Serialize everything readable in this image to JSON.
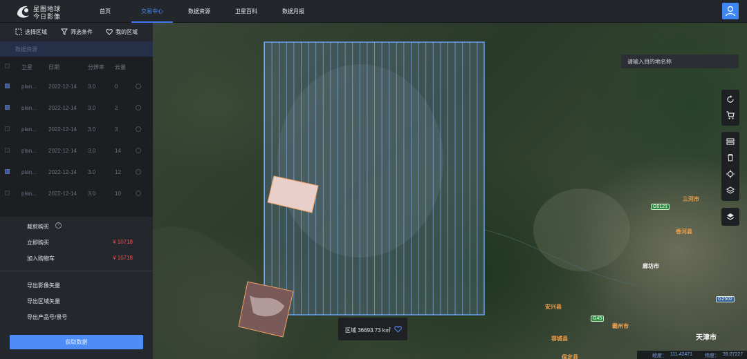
{
  "brand": {
    "line1": "星图地球",
    "line2": "今日影像"
  },
  "nav": [
    {
      "label": "首页",
      "active": false
    },
    {
      "label": "交易中心",
      "active": true
    },
    {
      "label": "数据资源",
      "active": false
    },
    {
      "label": "卫星百科",
      "active": false
    },
    {
      "label": "数据月报",
      "active": false
    }
  ],
  "panel": {
    "tabs": [
      {
        "label": "选择区域",
        "icon": "select-area-icon"
      },
      {
        "label": "筛选条件",
        "icon": "filter-icon"
      },
      {
        "label": "我的区域",
        "icon": "heart-icon"
      }
    ],
    "section_title": "数据资源",
    "table": {
      "headers": [
        "卫星",
        "日期",
        "分辨率",
        "云量"
      ],
      "rows": [
        {
          "checked": true,
          "satellite": "plan...",
          "date": "2022-12-14",
          "resolution": "3.0",
          "cloud": "0"
        },
        {
          "checked": true,
          "satellite": "plan...",
          "date": "2022-12-14",
          "resolution": "3.0",
          "cloud": "2"
        },
        {
          "checked": false,
          "satellite": "plan...",
          "date": "2022-12-14",
          "resolution": "3.0",
          "cloud": "3"
        },
        {
          "checked": false,
          "satellite": "plan...",
          "date": "2022-12-14",
          "resolution": "3.0",
          "cloud": "14"
        },
        {
          "checked": true,
          "satellite": "plan...",
          "date": "2022-12-14",
          "resolution": "3.0",
          "cloud": "12"
        },
        {
          "checked": false,
          "satellite": "plan...",
          "date": "2022-12-14",
          "resolution": "3.0",
          "cloud": "10"
        }
      ]
    },
    "buy": {
      "crop_label": "裁剪购买",
      "buy_now_label": "立即购买",
      "buy_now_price": "¥ 10718",
      "cart_label": "加入购物车",
      "cart_price": "¥ 10718"
    },
    "exports": [
      "导出影像矢量",
      "导出区域矢量",
      "导出产品号/景号"
    ],
    "primary_button": "获取数据"
  },
  "map": {
    "search_placeholder": "请输入目的地名称",
    "area_label": "区域 36693.73 k㎡",
    "coords": {
      "lon_label": "经度：",
      "lon": "111.42471",
      "lat_label": "纬度：",
      "lat": "39.07227"
    },
    "cities": [
      {
        "name": "天津市",
        "style": "white"
      },
      {
        "name": "三河市",
        "style": "orange"
      },
      {
        "name": "香河县",
        "style": "orange"
      },
      {
        "name": "廊坊市",
        "style": "white"
      },
      {
        "name": "安兴县",
        "style": "orange"
      },
      {
        "name": "霸州市",
        "style": "orange"
      },
      {
        "name": "容城县",
        "style": "orange"
      },
      {
        "name": "保定县",
        "style": "orange"
      }
    ],
    "roads": [
      "G0121",
      "G45",
      "G2502"
    ],
    "accent_color": "#4f8cf6",
    "footprint_color": "#6aa6ff"
  }
}
